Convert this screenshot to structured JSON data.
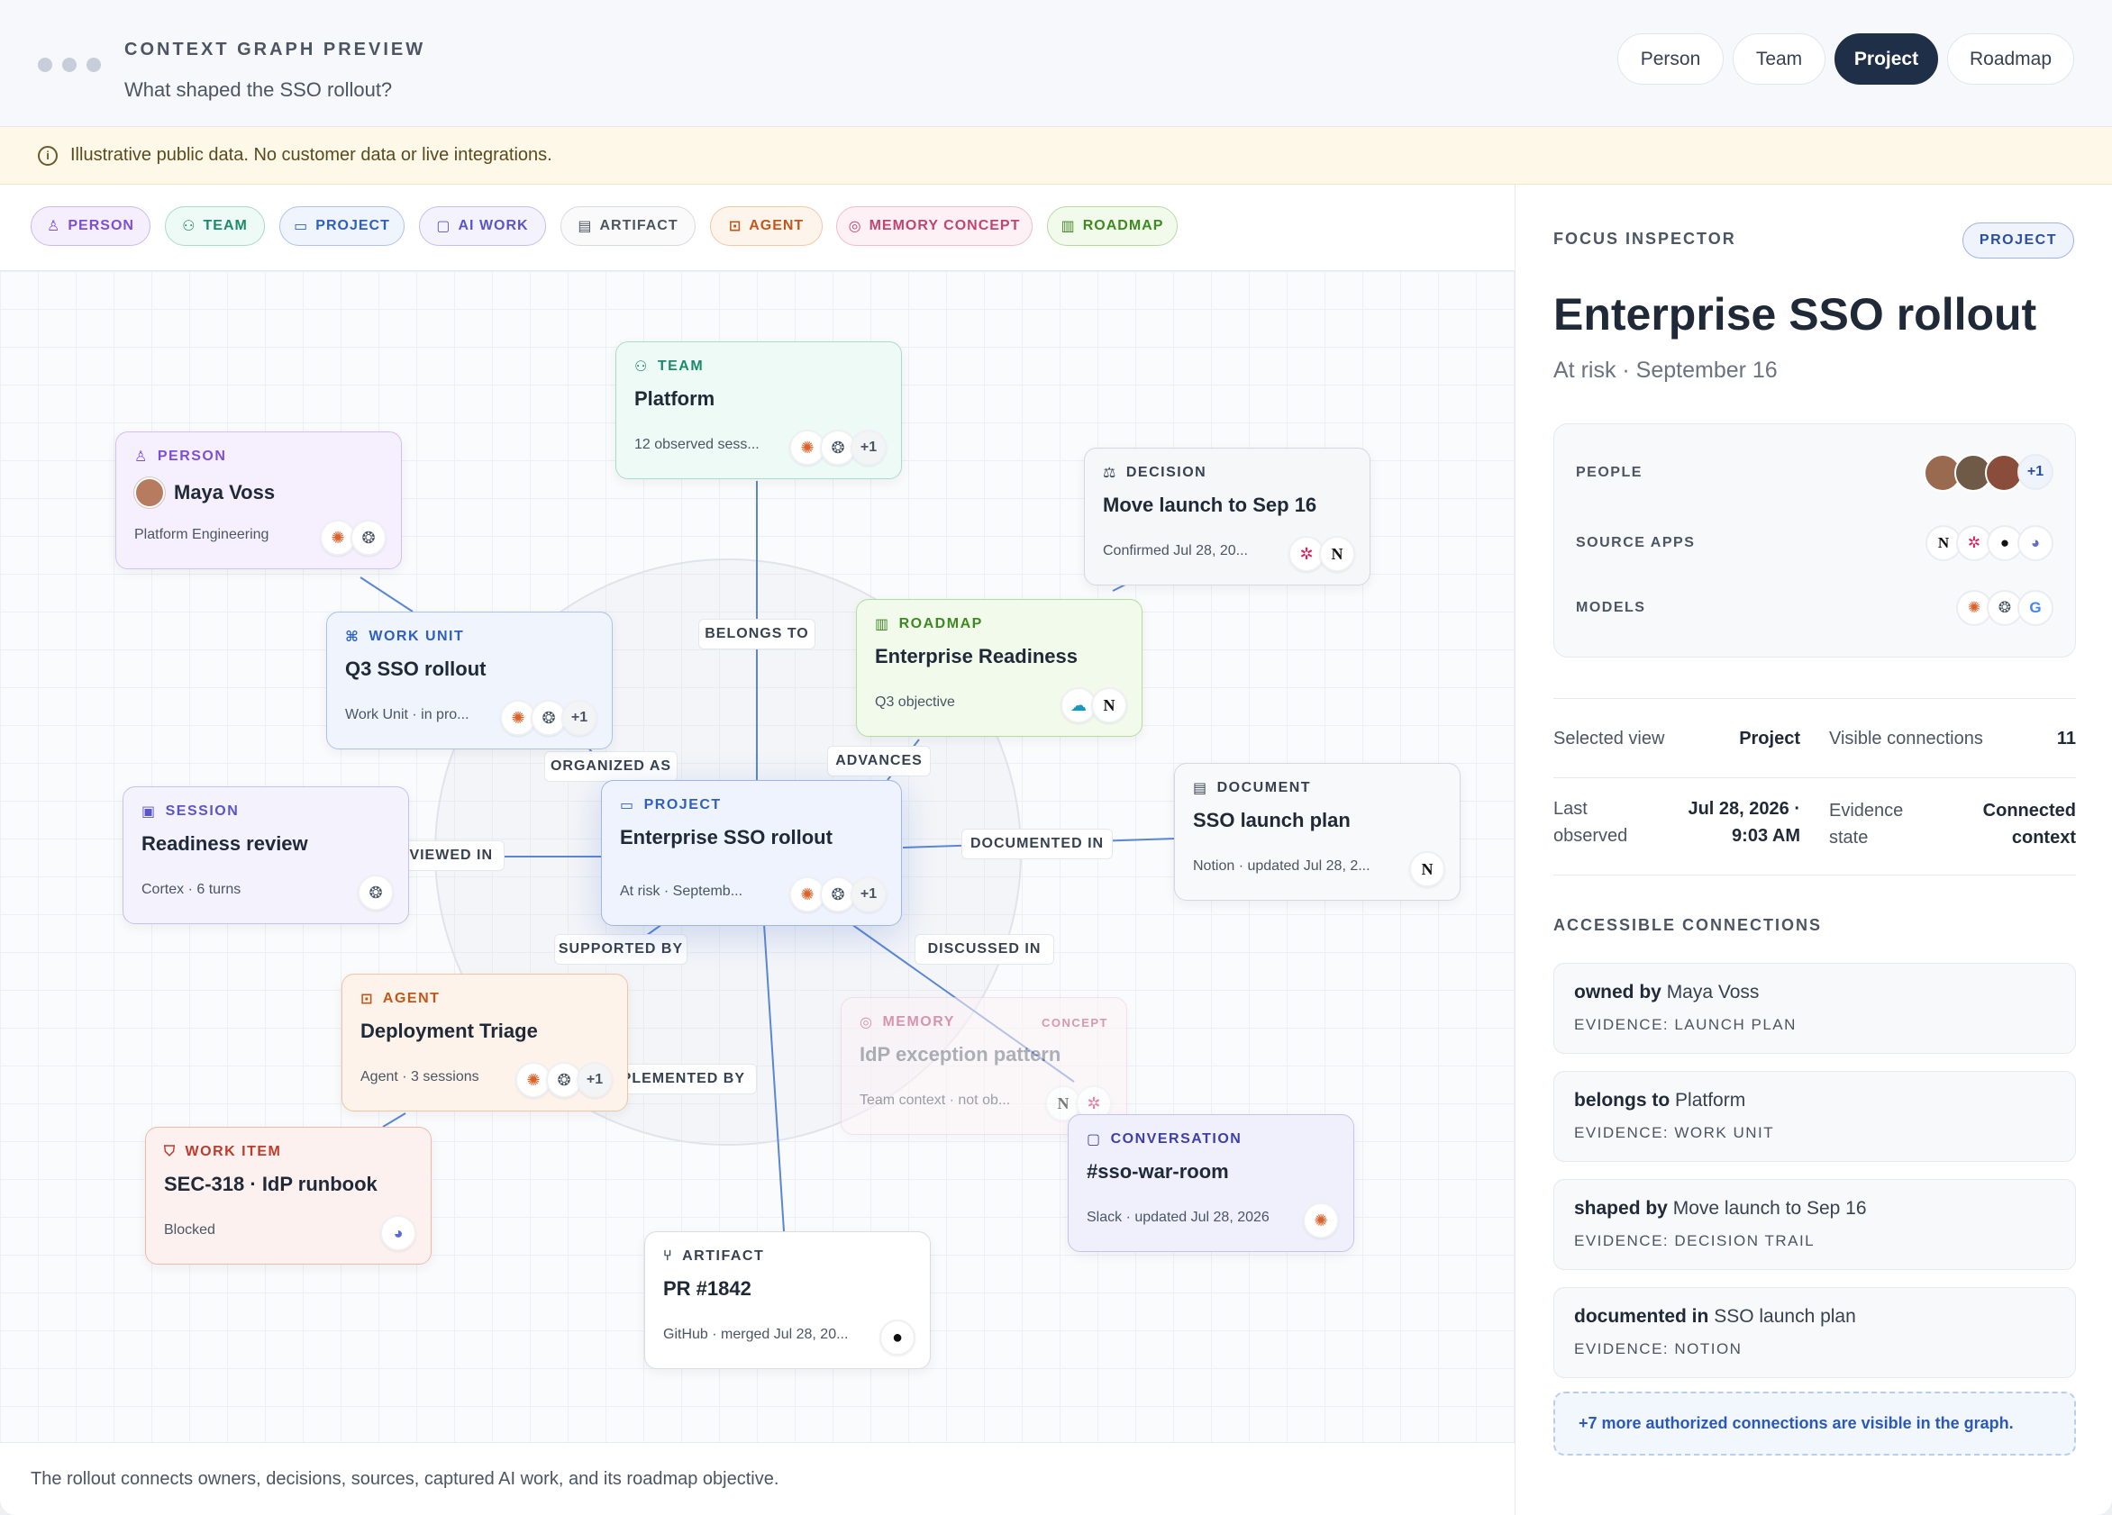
{
  "header": {
    "eyebrow": "CONTEXT GRAPH PREVIEW",
    "subtitle": "What shaped the SSO rollout?",
    "views": [
      {
        "label": "Person",
        "active": false
      },
      {
        "label": "Team",
        "active": false
      },
      {
        "label": "Project",
        "active": true
      },
      {
        "label": "Roadmap",
        "active": false
      }
    ]
  },
  "notice": "Illustrative public data. No customer data or live integrations.",
  "legend": [
    "PERSON",
    "TEAM",
    "PROJECT",
    "AI WORK",
    "ARTIFACT",
    "AGENT",
    "MEMORY CONCEPT",
    "ROADMAP"
  ],
  "edge_labels": {
    "belongs_to": "BELONGS TO",
    "organized_as": "ORGANIZED AS",
    "advances": "ADVANCES",
    "viewed_in": "VIEWED IN",
    "documented_in": "DOCUMENTED IN",
    "supported_by": "SUPPORTED BY",
    "discussed_in": "DISCUSSED IN",
    "implemented_by": "IMPLEMENTED BY"
  },
  "nodes": {
    "team": {
      "kind": "TEAM",
      "title": "Platform",
      "meta": "12 observed sess...",
      "more": "+1"
    },
    "person": {
      "kind": "PERSON",
      "title": "Maya Voss",
      "meta": "Platform Engineering"
    },
    "decision": {
      "kind": "DECISION",
      "title": "Move launch to Sep 16",
      "meta": "Confirmed Jul 28, 20..."
    },
    "workunit": {
      "kind": "WORK UNIT",
      "title": "Q3 SSO rollout",
      "meta": "Work Unit · in pro...",
      "more": "+1"
    },
    "roadmap": {
      "kind": "ROADMAP",
      "title": "Enterprise Readiness",
      "meta": "Q3 objective"
    },
    "session": {
      "kind": "SESSION",
      "title": "Readiness review",
      "meta": "Cortex · 6 turns"
    },
    "project": {
      "kind": "PROJECT",
      "title": "Enterprise SSO rollout",
      "meta": "At risk · Septemb...",
      "more": "+1"
    },
    "document": {
      "kind": "DOCUMENT",
      "title": "SSO launch plan",
      "meta": "Notion · updated Jul 28, 2..."
    },
    "agent": {
      "kind": "AGENT",
      "title": "Deployment Triage",
      "meta": "Agent · 3 sessions",
      "more": "+1"
    },
    "memory": {
      "kind": "MEMORY",
      "tag": "CONCEPT",
      "title": "IdP exception pattern",
      "meta": "Team context · not ob..."
    },
    "workitem": {
      "kind": "WORK ITEM",
      "title": "SEC-318 · IdP runbook",
      "meta": "Blocked"
    },
    "conversation": {
      "kind": "CONVERSATION",
      "title": "#sso-war-room",
      "meta": "Slack · updated Jul 28, 2026"
    },
    "artifact": {
      "kind": "ARTIFACT",
      "title": "PR #1842",
      "meta": "GitHub · merged Jul 28, 20..."
    }
  },
  "caption": "The rollout connects owners, decisions, sources, captured AI work, and its roadmap objective.",
  "inspector": {
    "eyebrow": "FOCUS INSPECTOR",
    "badge": "PROJECT",
    "title": "Enterprise SSO rollout",
    "status": "At risk · September 16",
    "people_label": "PEOPLE",
    "people_more": "+1",
    "sources_label": "SOURCE APPS",
    "models_label": "MODELS",
    "stats": {
      "selected_view_k": "Selected view",
      "selected_view_v": "Project",
      "visible_k": "Visible connections",
      "visible_v": "11",
      "last_k1": "Last",
      "last_k2": "observed",
      "last_v1": "Jul 28, 2026 ·",
      "last_v2": "9:03 AM",
      "evidence_k1": "Evidence",
      "evidence_k2": "state",
      "evidence_v1": "Connected",
      "evidence_v2": "context"
    },
    "connections_heading": "ACCESSIBLE CONNECTIONS",
    "connections": [
      {
        "rel": "owned by",
        "target": "Maya Voss",
        "evidence": "EVIDENCE: LAUNCH PLAN"
      },
      {
        "rel": "belongs to",
        "target": "Platform",
        "evidence": "EVIDENCE: WORK UNIT"
      },
      {
        "rel": "shaped by",
        "target": "Move launch to Sep 16",
        "evidence": "EVIDENCE: DECISION TRAIL"
      },
      {
        "rel": "documented in",
        "target": "SSO launch plan",
        "evidence": "EVIDENCE: NOTION"
      }
    ],
    "more_connections": "+7 more authorized connections are visible in the graph."
  },
  "colors": {
    "person": "#7c4fd6",
    "team": "#1e8a6a",
    "project": "#2f5fc0",
    "ai_work": "#5b55c9",
    "artifact": "#4b5563",
    "agent": "#c2571a",
    "memory": "#c2456f",
    "roadmap": "#3e8a22",
    "workitem": "#c0392b",
    "active_view": "#1e2f47"
  },
  "icons": {
    "claude": "claude-icon",
    "openai": "openai-icon",
    "google": "google-icon",
    "slack": "slack-icon",
    "notion": "notion-icon",
    "github": "github-icon",
    "linear": "linear-icon",
    "salesforce": "salesforce-icon"
  }
}
